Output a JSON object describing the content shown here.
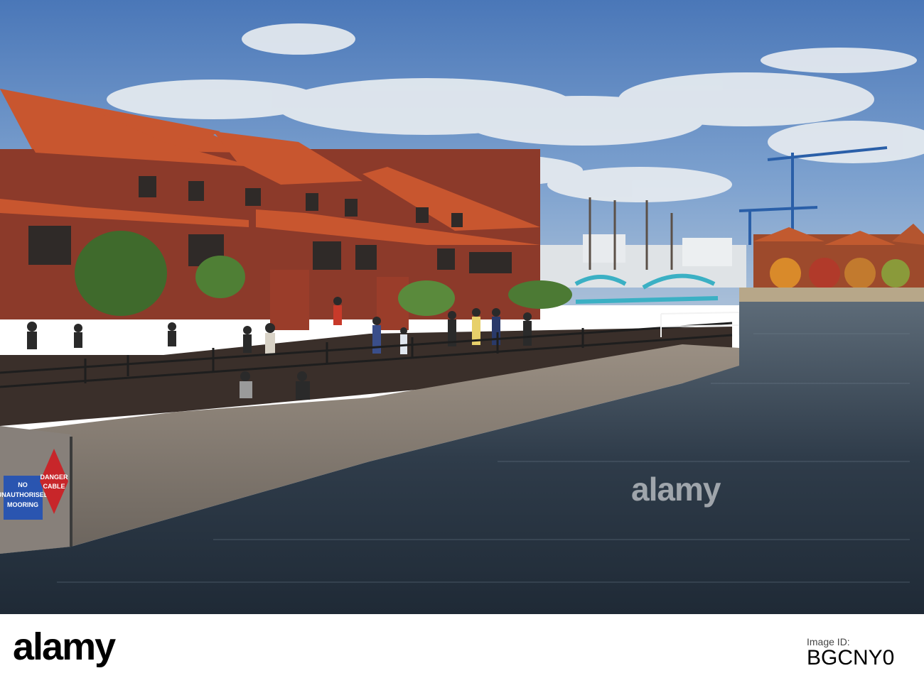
{
  "photo": {
    "description_alt": "",
    "sign_blue": [
      "NO",
      "UNAUTHORISED",
      "MOORING"
    ],
    "sign_red": [
      "DANGER",
      "CABLE"
    ]
  },
  "watermark": {
    "text": "alamy"
  },
  "footer": {
    "logo": "alamy",
    "stock_label": "Image ID:",
    "stock_id": "BGCNY0"
  }
}
